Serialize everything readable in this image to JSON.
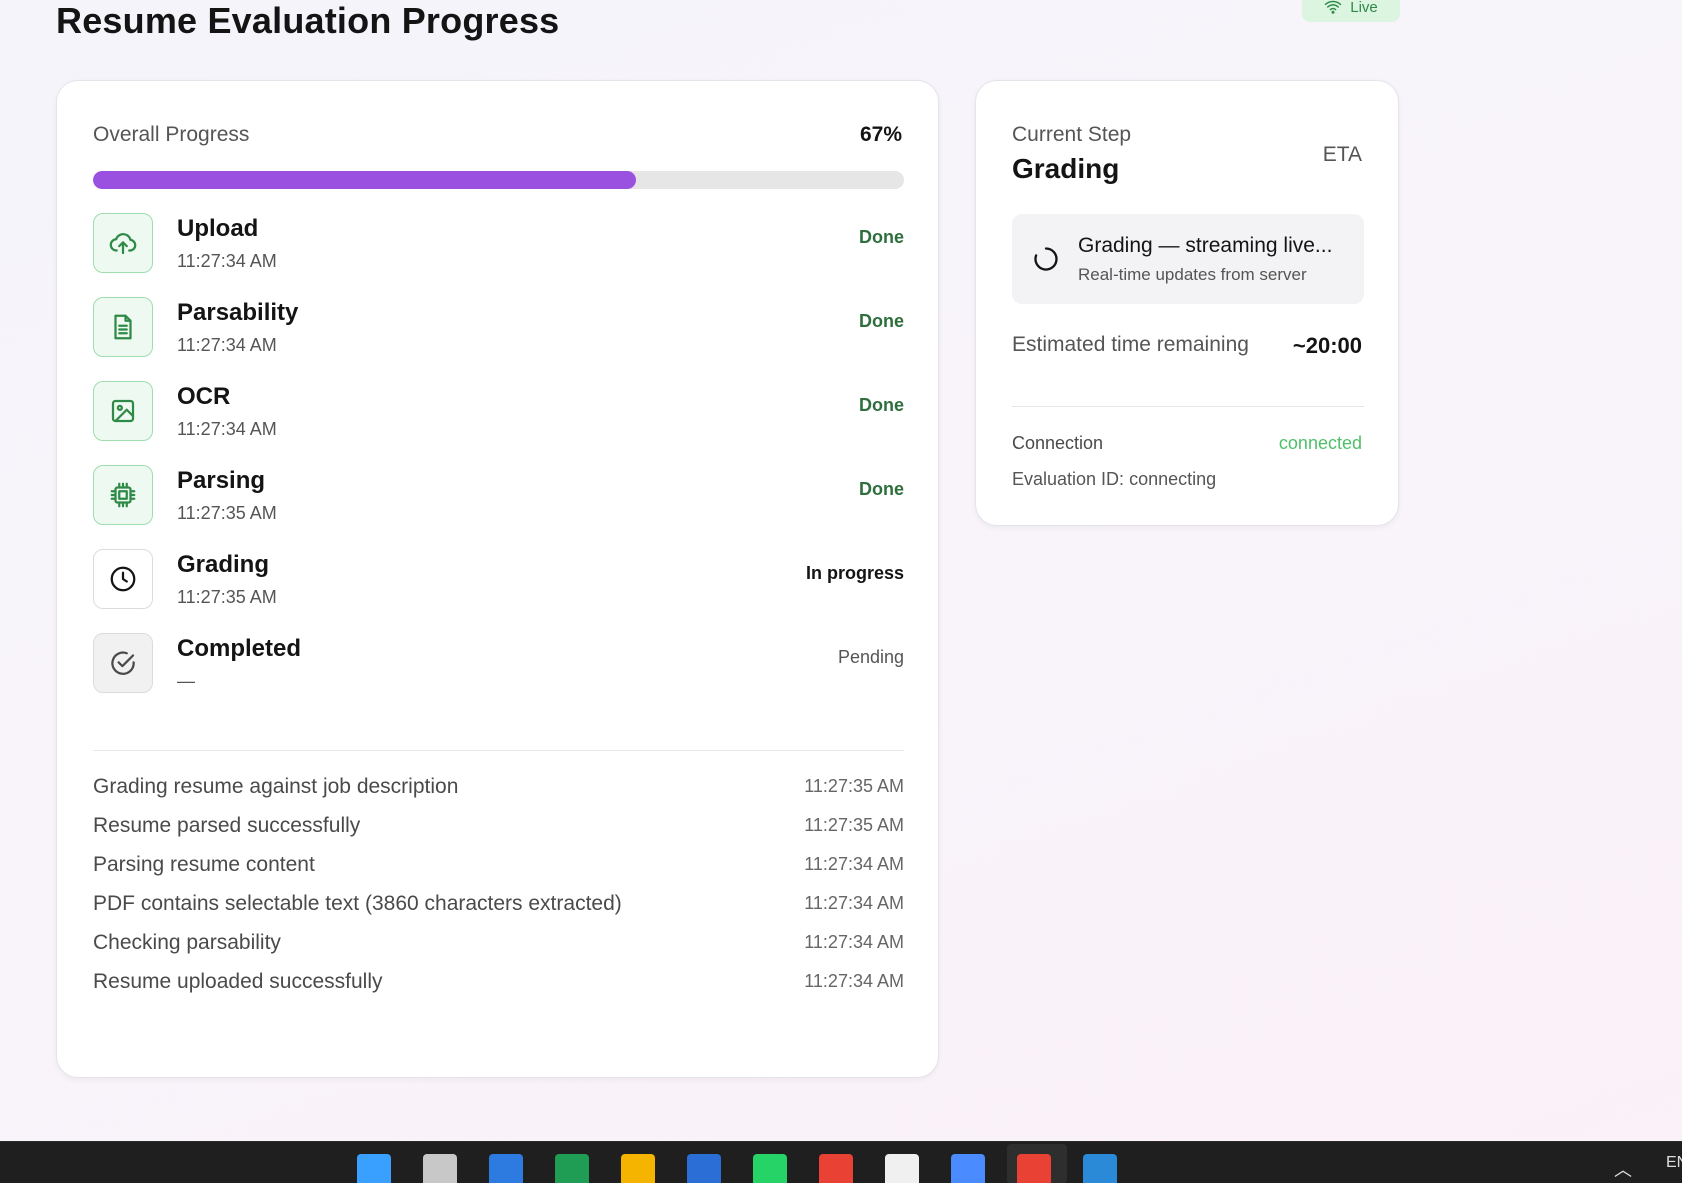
{
  "header": {
    "title": "Resume Evaluation Progress",
    "live_label": "Live"
  },
  "progress": {
    "label": "Overall Progress",
    "value_text": "67%",
    "percent": 67
  },
  "steps": [
    {
      "name": "Upload",
      "time": "11:27:34 AM",
      "status": "Done",
      "state": "done",
      "icon": "cloud-upload-icon"
    },
    {
      "name": "Parsability",
      "time": "11:27:34 AM",
      "status": "Done",
      "state": "done",
      "icon": "document-icon"
    },
    {
      "name": "OCR",
      "time": "11:27:34 AM",
      "status": "Done",
      "state": "done",
      "icon": "image-icon"
    },
    {
      "name": "Parsing",
      "time": "11:27:35 AM",
      "status": "Done",
      "state": "done",
      "icon": "cpu-chip-icon"
    },
    {
      "name": "Grading",
      "time": "11:27:35 AM",
      "status": "In progress",
      "state": "progress",
      "icon": "clock-icon"
    },
    {
      "name": "Completed",
      "time": "—",
      "status": "Pending",
      "state": "pending",
      "icon": "check-circle-icon"
    }
  ],
  "log": [
    {
      "message": "Grading resume against job description",
      "time": "11:27:35 AM"
    },
    {
      "message": "Resume parsed successfully",
      "time": "11:27:35 AM"
    },
    {
      "message": "Parsing resume content",
      "time": "11:27:34 AM"
    },
    {
      "message": "PDF contains selectable text (3860 characters extracted)",
      "time": "11:27:34 AM"
    },
    {
      "message": "Checking parsability",
      "time": "11:27:34 AM"
    },
    {
      "message": "Resume uploaded successfully",
      "time": "11:27:34 AM"
    }
  ],
  "current": {
    "label": "Current Step",
    "value": "Grading",
    "eta_label": "ETA",
    "stream_title": "Grading — streaming live...",
    "stream_sub": "Real-time updates from server",
    "remaining_label": "Estimated time remaining",
    "remaining_value": "~20:00",
    "connection_label": "Connection",
    "connection_value": "connected",
    "evaluation_id_label": "Evaluation ID:",
    "evaluation_id_value": "connecting"
  },
  "colors": {
    "accent": "#9b51e0",
    "done": "#2f8a47",
    "connected": "#4fbf6a"
  },
  "taskbar": {
    "icons": [
      "windows-start-icon",
      "task-view-icon",
      "stocks-app-icon",
      "excel-icon",
      "file-explorer-icon",
      "word-icon",
      "whatsapp-icon",
      "chrome-icon",
      "chatgpt-icon",
      "arc-browser-icon",
      "chrome-profile-icon",
      "vscode-icon"
    ],
    "language": "EN"
  }
}
